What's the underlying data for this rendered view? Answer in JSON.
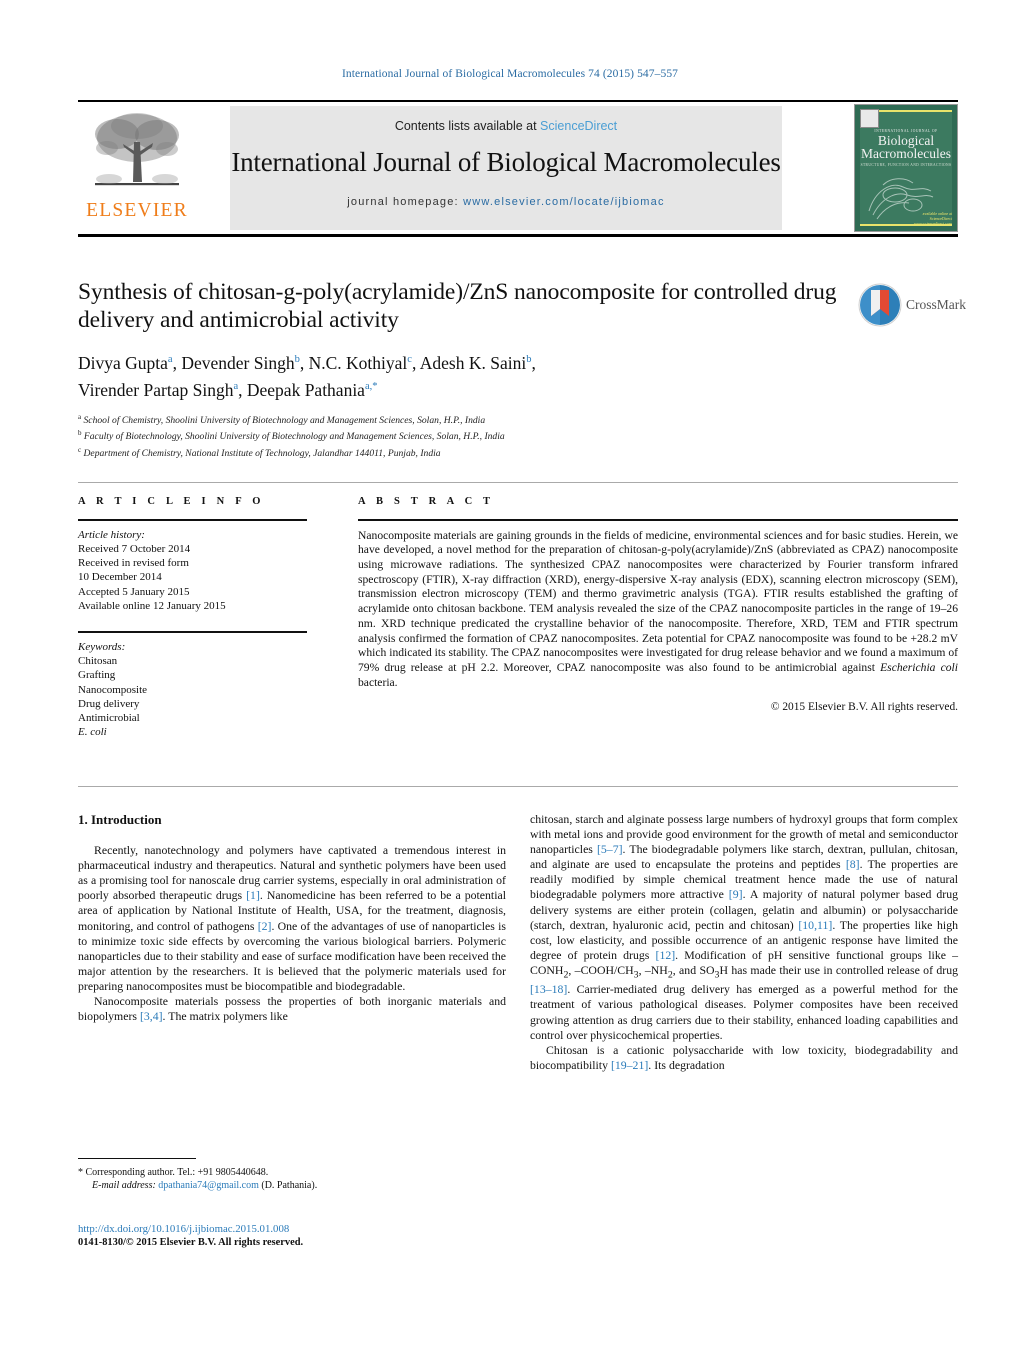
{
  "running_head": "International Journal of Biological Macromolecules 74 (2015) 547–557",
  "masthead": {
    "contents_prefix": "Contents lists available at ",
    "sciencedirect": "ScienceDirect",
    "journal_title": "International Journal of Biological Macromolecules",
    "homepage_prefix": "journal homepage: ",
    "homepage_url": "www.elsevier.com/locate/ijbiomac",
    "publisher_wordmark": "ELSEVIER",
    "cover": {
      "tiny_top": "INTERNATIONAL JOURNAL OF",
      "name_line1": "Biological",
      "name_line2": "Macromolecules",
      "subtitle": "STRUCTURE, FUNCTION AND INTERACTIONS",
      "foot_line1": "available online at",
      "foot_line2": "ScienceDirect",
      "foot_line3": "www.sciencedirect.com"
    }
  },
  "article": {
    "title": "Synthesis of chitosan-g-poly(acrylamide)/ZnS nanocomposite for controlled drug delivery and antimicrobial activity",
    "authors_line1": [
      {
        "name": "Divya Gupta",
        "sup": "a"
      },
      {
        "name": "Devender Singh",
        "sup": "b"
      },
      {
        "name": "N.C. Kothiyal",
        "sup": "c"
      },
      {
        "name": "Adesh K. Saini",
        "sup": "b"
      }
    ],
    "authors_line2": [
      {
        "name": "Virender Partap Singh",
        "sup": "a"
      },
      {
        "name": "Deepak Pathania",
        "sup": "a,*"
      }
    ],
    "affiliations": [
      {
        "mark": "a",
        "text": "School of Chemistry, Shoolini University of Biotechnology and Management Sciences, Solan, H.P., India"
      },
      {
        "mark": "b",
        "text": "Faculty of Biotechnology, Shoolini University of Biotechnology and Management Sciences, Solan, H.P., India"
      },
      {
        "mark": "c",
        "text": "Department of Chemistry, National Institute of Technology, Jalandhar 144011, Punjab, India"
      }
    ],
    "crossmark_label": "CrossMark"
  },
  "article_info": {
    "heading": "A R T I C L E   I N F O",
    "history_label": "Article history:",
    "history": [
      "Received 7 October 2014",
      "Received in revised form",
      "10 December 2014",
      "Accepted 5 January 2015",
      "Available online 12 January 2015"
    ],
    "keywords_label": "Keywords:",
    "keywords": [
      "Chitosan",
      "Grafting",
      "Nanocomposite",
      "Drug delivery",
      "Antimicrobial"
    ],
    "keyword_italic": "E. coli"
  },
  "abstract": {
    "heading": "A B S T R A C T",
    "text": "Nanocomposite materials are gaining grounds in the fields of medicine, environmental sciences and for basic studies. Herein, we have developed, a novel method for the preparation of chitosan-g-poly(acrylamide)/ZnS (abbreviated as CPAZ) nanocomposite using microwave radiations. The synthesized CPAZ nanocomposites were characterized by Fourier transform infrared spectroscopy (FTIR), X-ray diffraction (XRD), energy-dispersive X-ray analysis (EDX), scanning electron microscopy (SEM), transmission electron microscopy (TEM) and thermo gravimetric analysis (TGA). FTIR results established the grafting of acrylamide onto chitosan backbone. TEM analysis revealed the size of the CPAZ nanocomposite particles in the range of 19–26 nm. XRD technique predicated the crystalline behavior of the nanocomposite. Therefore, XRD, TEM and FTIR spectrum analysis confirmed the formation of CPAZ nanocomposites. Zeta potential for CPAZ nanocomposite was found to be +28.2 mV which indicated its stability. The CPAZ nanocomposites were investigated for drug release behavior and we found a maximum of 79% drug release at pH 2.2. Moreover, CPAZ nanocomposite was also found to be antimicrobial against ",
    "text_italic": "Escherichia coli",
    "text_tail": " bacteria.",
    "copyright": "© 2015 Elsevier B.V. All rights reserved."
  },
  "body": {
    "section_number_title": "1.  Introduction",
    "left_paragraphs": [
      {
        "parts": [
          {
            "t": "Recently, nanotechnology and polymers have captivated a tremendous interest in pharmaceutical industry and therapeutics. Natural and synthetic polymers have been used as a promising tool for nanoscale drug carrier systems, especially in oral administration of poorly absorbed therapeutic drugs "
          },
          {
            "t": "[1]",
            "ref": true
          },
          {
            "t": ". Nanomedicine has been referred to be a potential area of application by National Institute of Health, USA, for the treatment, diagnosis, monitoring, and control of pathogens "
          },
          {
            "t": "[2]",
            "ref": true
          },
          {
            "t": ". One of the advantages of use of nanoparticles is to minimize toxic side effects by overcoming the various biological barriers. Polymeric nanoparticles due to their stability and ease of surface modification have been received the major attention by the researchers. It is believed that the polymeric materials used for preparing nanocomposites must be biocompatible and biodegradable."
          }
        ]
      },
      {
        "parts": [
          {
            "t": "Nanocomposite materials possess the properties of both inorganic materials and biopolymers "
          },
          {
            "t": "[3,4]",
            "ref": true
          },
          {
            "t": ". The matrix polymers like"
          }
        ]
      }
    ],
    "right_paragraphs": [
      {
        "noindent": true,
        "parts": [
          {
            "t": "chitosan, starch and alginate possess large numbers of hydroxyl groups that form complex with metal ions and provide good environment for the growth of metal and semiconductor nanoparticles "
          },
          {
            "t": "[5–7]",
            "ref": true
          },
          {
            "t": ". The biodegradable polymers like starch, dextran, pullulan, chitosan, and alginate are used to encapsulate the proteins and peptides "
          },
          {
            "t": "[8]",
            "ref": true
          },
          {
            "t": ". The properties are readily modified by simple chemical treatment hence made the use of natural biodegradable polymers more attractive "
          },
          {
            "t": "[9]",
            "ref": true
          },
          {
            "t": ". A majority of natural polymer based drug delivery systems are either protein (collagen, gelatin and albumin) or polysaccharide (starch, dextran, hyaluronic acid, pectin and chitosan) "
          },
          {
            "t": "[10,11]",
            "ref": true
          },
          {
            "t": ". The properties like high cost, low elasticity, and possible occurrence of an antigenic response have limited the degree of protein drugs "
          },
          {
            "t": "[12]",
            "ref": true
          },
          {
            "t": ". Modification of pH sensitive functional groups like –CONH"
          },
          {
            "t": "2",
            "sub": true
          },
          {
            "t": ", –COOH/CH"
          },
          {
            "t": "3",
            "sub": true
          },
          {
            "t": ", –NH"
          },
          {
            "t": "2",
            "sub": true
          },
          {
            "t": ", and SO"
          },
          {
            "t": "3",
            "sub": true
          },
          {
            "t": "H has made their use in controlled release of drug "
          },
          {
            "t": "[13–18]",
            "ref": true
          },
          {
            "t": ". Carrier-mediated drug delivery has emerged as a powerful method for the treatment of various pathological diseases. Polymer composites have been received growing attention as drug carriers due to their stability, enhanced loading capabilities and control over physicochemical properties."
          }
        ]
      },
      {
        "parts": [
          {
            "t": "Chitosan is a cationic polysaccharide with low toxicity, biodegradability and biocompatibility "
          },
          {
            "t": "[19–21]",
            "ref": true
          },
          {
            "t": ". Its degradation"
          }
        ]
      }
    ]
  },
  "footer": {
    "corresponding_mark": "*",
    "corresponding_text": "Corresponding author. Tel.: +91 9805440648.",
    "email_label": "E-mail address:",
    "email": "dpathania74@gmail.com",
    "email_attrib": "(D. Pathania).",
    "doi": "http://dx.doi.org/10.1016/j.ijbiomac.2015.01.008",
    "issn_line": "0141-8130/© 2015 Elsevier B.V. All rights reserved."
  },
  "colors": {
    "link": "#2b7bb9",
    "elsevier_orange": "#ef7d1a",
    "band_grey": "#e6e6e6",
    "cover_green": "#2f6b54"
  }
}
